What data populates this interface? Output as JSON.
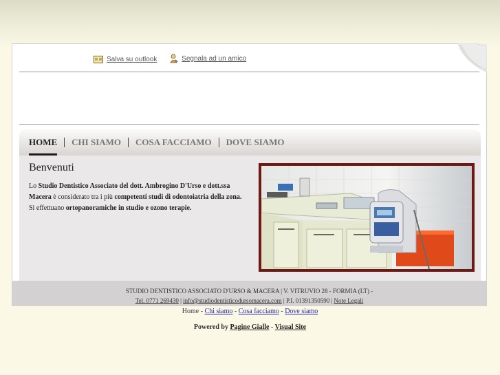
{
  "topbar": {
    "outlook_label": "Salva su outlook",
    "friend_label": "Segnala ad un amico"
  },
  "nav": {
    "items": [
      "HOME",
      "CHI SIAMO",
      "COSA FACCIAMO",
      "DOVE SIAMO"
    ],
    "active": "HOME"
  },
  "welcome": {
    "title": "Benvenuti",
    "t1": "Lo ",
    "b1": "Studio Dentistico Associato del dott. Ambrogino D'Urso e dott.ssa Macera",
    "t2": " è considerato tra i più ",
    "b2": "competenti studi di odontoiatria della zona.",
    "t3": " Si effettuano ",
    "b3": "ortopanoramiche in studio e ozono terapie."
  },
  "footer": {
    "line1": "STUDIO DENTISTICO ASSOCIATO D'URSO & MACERA | V. VITRUVIO 28 - FORMIA (LT) -",
    "tel": "Tel. 0771 269430",
    "sep1": " | ",
    "email": "info@studiodentisticodursomacera.com",
    "piva": " | P.I. 01391350590 | ",
    "legal": "Note Legali"
  },
  "bottom_nav": {
    "home": "Home",
    "chi": "Chi siamo",
    "cosa": "Cosa facciamo",
    "dove": "Dove siamo"
  },
  "powered": {
    "label": "Powered by",
    "pg": "Pagine Gialle",
    "vs": "Visual Site"
  },
  "colors": {
    "frame": "#6d1a14",
    "content_bg": "#ebe8ea",
    "footer_bg": "#d3d1d1"
  }
}
